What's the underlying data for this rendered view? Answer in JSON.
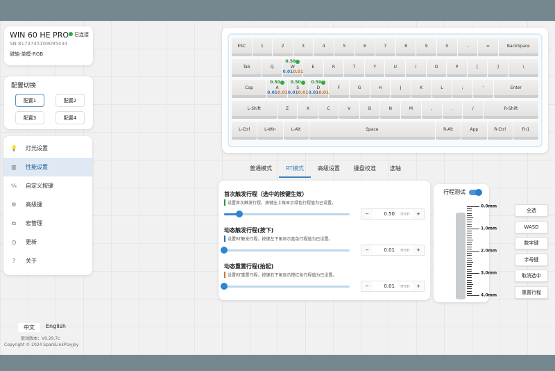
{
  "device": {
    "name": "WIN 60 HE PRO",
    "status": "已连接",
    "sn": "SN:8173745109095434",
    "type": "磁轴-单模-RGB"
  },
  "profiles": {
    "title": "配置切换",
    "items": [
      "配置1",
      "配置2",
      "配置3",
      "配置4"
    ],
    "active": 0
  },
  "menu": [
    {
      "icon": "bulb-icon",
      "glyph": "💡",
      "label": "灯光设置"
    },
    {
      "icon": "bar-chart-icon",
      "glyph": "▥",
      "label": "性能设置"
    },
    {
      "icon": "keymap-icon",
      "glyph": "⁰⁄₈",
      "label": "自定义按键"
    },
    {
      "icon": "advanced-key-icon",
      "glyph": "⚙",
      "label": "高级键"
    },
    {
      "icon": "macro-icon",
      "glyph": "⧉",
      "label": "宏管理"
    },
    {
      "icon": "update-icon",
      "glyph": "◷",
      "label": "更新"
    },
    {
      "icon": "help-icon",
      "glyph": "?",
      "label": "关于"
    }
  ],
  "menu_active": 1,
  "language": {
    "zh": "中文",
    "en": "English"
  },
  "version": "驱动版本：V0.29.7c",
  "copyright": "Copyright © 2024 SparkLinkPlayJoy",
  "keyboard": {
    "rows": [
      [
        [
          "ESC",
          1
        ],
        [
          "1",
          1
        ],
        [
          "2",
          1
        ],
        [
          "3",
          1
        ],
        [
          "4",
          1
        ],
        [
          "5",
          1
        ],
        [
          "6",
          1
        ],
        [
          "7",
          1
        ],
        [
          "8",
          1
        ],
        [
          "9",
          1
        ],
        [
          "0",
          1
        ],
        [
          "-",
          1
        ],
        [
          "=",
          1
        ],
        [
          "BackSpace",
          2
        ]
      ],
      [
        [
          "Tab",
          1.5
        ],
        [
          "Q",
          1
        ],
        [
          "W",
          1
        ],
        [
          "E",
          1
        ],
        [
          "R",
          1
        ],
        [
          "T",
          1
        ],
        [
          "Y",
          1
        ],
        [
          "U",
          1
        ],
        [
          "I",
          1
        ],
        [
          "O",
          1
        ],
        [
          "P",
          1
        ],
        [
          "[",
          1
        ],
        [
          "]",
          1
        ],
        [
          "\\",
          1.5
        ]
      ],
      [
        [
          "Cap",
          1.75
        ],
        [
          "A",
          1
        ],
        [
          "S",
          1
        ],
        [
          "D",
          1
        ],
        [
          "F",
          1
        ],
        [
          "G",
          1
        ],
        [
          "H",
          1
        ],
        [
          "J",
          1
        ],
        [
          "K",
          1
        ],
        [
          "L",
          1
        ],
        [
          ";",
          1
        ],
        [
          "'",
          1
        ],
        [
          "Enter",
          2.25
        ]
      ],
      [
        [
          "L-Shift",
          2.25
        ],
        [
          "Z",
          1
        ],
        [
          "X",
          1
        ],
        [
          "C",
          1
        ],
        [
          "V",
          1
        ],
        [
          "B",
          1
        ],
        [
          "N",
          1
        ],
        [
          "M",
          1
        ],
        [
          ",",
          1
        ],
        [
          ".",
          1
        ],
        [
          "/",
          1
        ],
        [
          "R-Shift",
          2.75
        ]
      ],
      [
        [
          "L-Ctrl",
          1.25
        ],
        [
          "L-Win",
          1.25
        ],
        [
          "L-Alt",
          1.25
        ],
        [
          "Space",
          6.25
        ],
        [
          "R-Alt",
          1.25
        ],
        [
          "App",
          1.25
        ],
        [
          "R-Ctrl",
          1.25
        ],
        [
          "Fn1",
          1.25
        ]
      ]
    ],
    "configured": {
      "W": {
        "first": "0.50",
        "press": "0.01",
        "release": "0.01"
      },
      "A": {
        "first": "0.50",
        "press": "0.01",
        "release": "0.01"
      },
      "S": {
        "first": "0.50",
        "press": "0.01",
        "release": "0.01"
      },
      "D": {
        "first": "0.50",
        "press": "0.01",
        "release": "0.01"
      }
    }
  },
  "tabs": [
    "普通模式",
    "RT模式",
    "高级设置",
    "键盘校准",
    "选轴"
  ],
  "tab_active": 1,
  "settings": [
    {
      "title": "首次触发行程（选中的按键生效）",
      "desc": "设置首次触发行程，按键左上角显示绿色行程值为已设置。",
      "color": "#2f8f3a",
      "value": "0.50",
      "unit": "mm",
      "fraction": 0.12
    },
    {
      "title": "动态触发行程(按下)",
      "desc": "设置RT触发行程，按键左下角显示蓝色行程值为已设置。",
      "color": "#2a6aa8",
      "value": "0.01",
      "unit": "mm",
      "fraction": 0
    },
    {
      "title": "动态重置行程(抬起)",
      "desc": "设置RT重置行程，按键右下角显示橙红色行程值为已设置。",
      "color": "#d0742e",
      "value": "0.01",
      "unit": "mm",
      "fraction": 0
    }
  ],
  "travel": {
    "title": "行程测试",
    "enabled": true,
    "labels": [
      "0.0mm",
      "1.0mm",
      "2.0mm",
      "3.0mm",
      "4.0mm"
    ]
  },
  "quick": [
    "全选",
    "WASD",
    "数字键",
    "字母键",
    "取消选中",
    "重置行程"
  ]
}
